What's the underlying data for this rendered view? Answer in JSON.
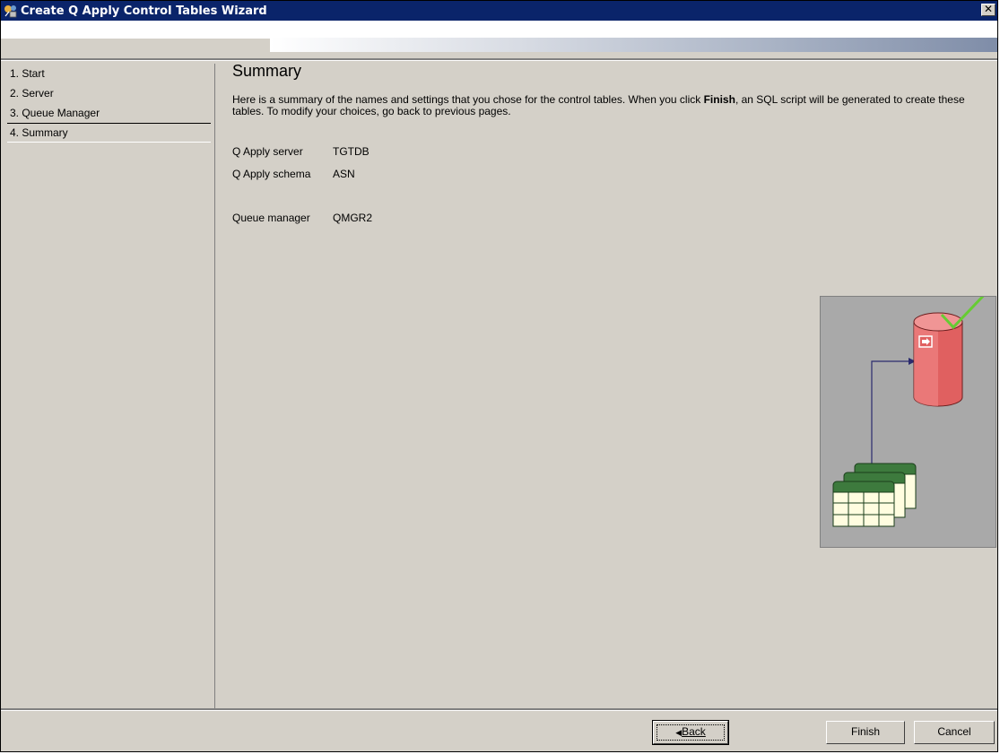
{
  "window": {
    "title": "Create Q Apply Control Tables Wizard",
    "close_label": "✕"
  },
  "nav": {
    "items": [
      {
        "label": "1. Start"
      },
      {
        "label": "2. Server"
      },
      {
        "label": "3. Queue Manager"
      },
      {
        "label": "4. Summary",
        "selected": true
      }
    ]
  },
  "summary": {
    "title": "Summary",
    "description_part1": "Here is a summary of the names and settings that you chose for the control tables.  When you click ",
    "description_bold": "Finish",
    "description_part2": ", an SQL script will be generated to create these tables.  To modify your choices, go back to previous pages.",
    "fields": [
      {
        "label": "Q Apply server",
        "value": "TGTDB"
      },
      {
        "label": "Q Apply schema",
        "value": "ASN"
      },
      {
        "label": "Queue manager",
        "value": "QMGR2"
      }
    ]
  },
  "buttons": {
    "back_label": "Back",
    "finish_label": "Finish",
    "cancel_label": "Cancel"
  },
  "illustration": {
    "db_color": "#e06060",
    "check_color": "#66cc33",
    "table_header_color": "#3d7a3d",
    "table_cell_color": "#fffde0",
    "arrow_color": "#2b2b6e",
    "panel_color": "#a9a9a9"
  }
}
